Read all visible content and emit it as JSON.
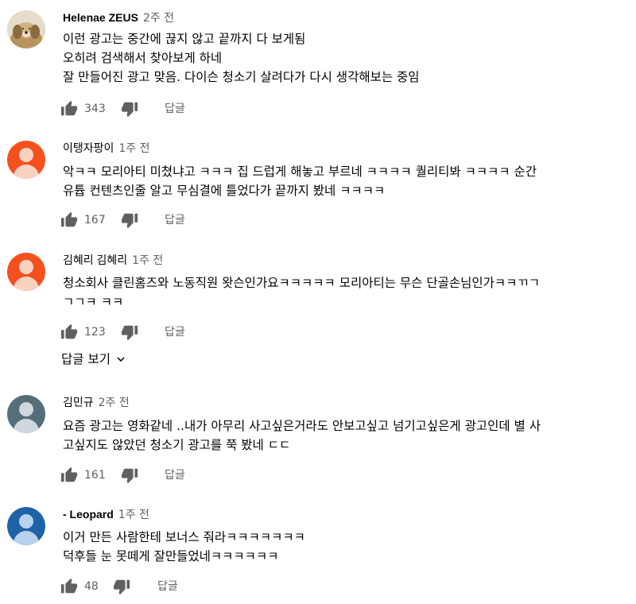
{
  "comments": [
    {
      "author": "Helenae ZEUS",
      "time": "2주 전",
      "lines": [
        "이런 광고는 중간에 끊지 않고 끝까지 다 보게됨",
        "오히려 검색해서 찾아보게 하네",
        "잘 만들어진 광고 맞음. 다이슨 청소기 살려다가 다시 생각해보는 중임"
      ],
      "likes": "343",
      "reply_label": "답글",
      "avatar": "dog-photo"
    },
    {
      "author": "이탱자팡이",
      "time": "1주 전",
      "lines": [
        "악ㅋㅋ 모리아티 미쳤냐고 ㅋㅋㅋ 집 드럽게 해놓고 부르네 ㅋㅋㅋㅋ 퀄리티봐 ㅋㅋㅋㅋ 순간",
        "유튭 컨텐츠인줄 알고 무심결에 틀었다가 끝까지 봤네 ㅋㅋㅋㅋ"
      ],
      "likes": "167",
      "reply_label": "답글",
      "avatar": "default-orange"
    },
    {
      "author": "김혜리 김혜리",
      "time": "1주 전",
      "lines": [
        "청소회사 클린홈즈와 노동직원 왓슨인가요ㅋㅋㅋㅋㅋ 모리아티는 무슨 단골손님인가ㅋㅋㄲㄱ",
        "ㄱㄱㅋ ㅋㅋ"
      ],
      "likes": "123",
      "reply_label": "답글",
      "avatar": "default-orange"
    },
    {
      "author": "김민규",
      "time": "2주 전",
      "lines": [
        "요즘 광고는 영화같네 ..내가  아무리 사고싶은거라도 안보고싶고 넘기고싶은게 광고인데 별 사",
        "고싶지도 않았던 청소기 광고를 쭉 봤네 ㄷㄷ"
      ],
      "likes": "161",
      "reply_label": "답글",
      "avatar": "default-slate"
    },
    {
      "author": "- Leopard",
      "time": "1주 전",
      "lines": [
        "이거 만든 사람한테 보너스 줘라ㅋㅋㅋㅋㅋㅋㅋ",
        "덕후들 눈 못떼게 잘만들었네ㅋㅋㅋㅋㅋㅋ"
      ],
      "likes": "48",
      "reply_label": "답글",
      "avatar": "default-blue"
    }
  ],
  "view_replies_label": "답글 보기",
  "colors": {
    "primary_text": "#030303",
    "secondary_text": "#606060",
    "icon": "#606060"
  }
}
